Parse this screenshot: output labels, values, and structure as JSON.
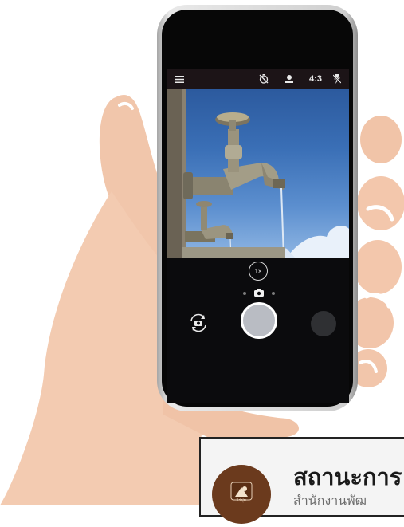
{
  "camera": {
    "ratio_label": "4:3",
    "zoom_label": "1×",
    "icons": [
      "menu-icon",
      "timer-off-icon",
      "hdr-icon",
      "flash-off-icon",
      "switch-camera-icon",
      "photo-mode-icon"
    ]
  },
  "card": {
    "logo_caption": "ไร่ชุ่ม",
    "title": "สถานะการ",
    "subtitle": "สำนักงานพัฒ"
  },
  "colors": {
    "camera_topbar": "#1c1417",
    "sky": "#3a6fb6",
    "shutter": "#b9bcc3",
    "logo": "#6b3a1d"
  }
}
